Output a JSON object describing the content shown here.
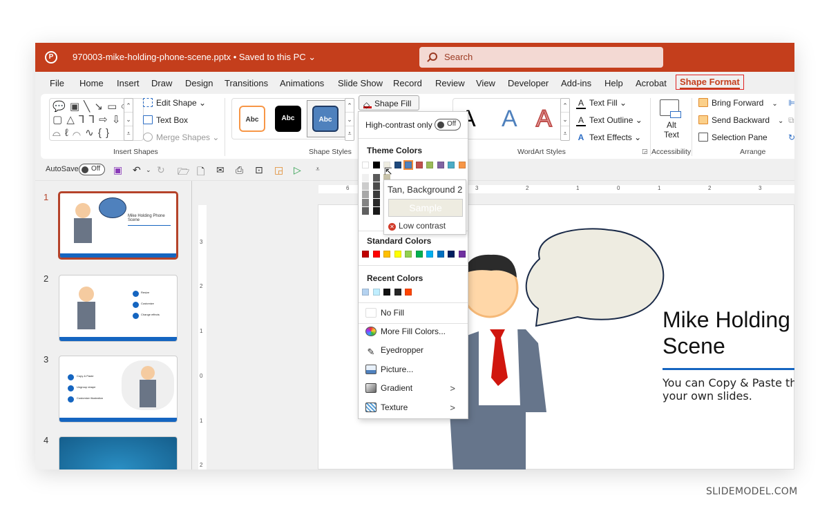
{
  "titlebar": {
    "app_icon": "powerpoint-icon",
    "doc_title": "970003-mike-holding-phone-scene.pptx • Saved to this PC ⌄",
    "search_placeholder": "Search"
  },
  "tabs": [
    {
      "label": "File"
    },
    {
      "label": "Home"
    },
    {
      "label": "Insert"
    },
    {
      "label": "Draw"
    },
    {
      "label": "Design"
    },
    {
      "label": "Transitions"
    },
    {
      "label": "Animations"
    },
    {
      "label": "Slide Show"
    },
    {
      "label": "Record"
    },
    {
      "label": "Review"
    },
    {
      "label": "View"
    },
    {
      "label": "Developer"
    },
    {
      "label": "Add-ins"
    },
    {
      "label": "Help"
    },
    {
      "label": "Acrobat"
    },
    {
      "label": "Shape Format",
      "active": true
    }
  ],
  "ribbon": {
    "insert_shapes": {
      "label": "Insert Shapes",
      "edit_shape": "Edit Shape ⌄",
      "text_box": "Text Box",
      "merge_shapes": "Merge Shapes ⌄",
      "gallery_rows": [
        "💬 ▣ ╲ ↘ ▭ ⬭",
        "▢ △ ⅂ ⅂ ⇨ ⇩",
        "⌓ ℓ ⌒ ∿ { }"
      ]
    },
    "shape_styles": {
      "label": "Shape Styles",
      "samples": [
        "Abc",
        "Abc",
        "Abc"
      ],
      "shape_fill": "Shape Fill ⌄"
    },
    "wordart_styles": {
      "label": "WordArt Styles",
      "samples": [
        "A",
        "A",
        "A"
      ],
      "text_fill": "Text Fill ⌄",
      "text_outline": "Text Outline ⌄",
      "text_effects": "Text Effects ⌄"
    },
    "accessibility": {
      "label": "Accessibility",
      "alt_text_1": "Alt",
      "alt_text_2": "Text"
    },
    "arrange": {
      "label": "Arrange",
      "bring_forward": "Bring Forward",
      "send_backward": "Send Backward",
      "selection_pane": "Selection Pane"
    }
  },
  "qat": {
    "autosave_label": "AutoSave",
    "autosave_state": "Off"
  },
  "slides": [
    {
      "num": "1",
      "title": "Mike Holding Phone Scene",
      "selected": true
    },
    {
      "num": "2",
      "items": [
        "Resize",
        "Customize",
        "Change effects"
      ]
    },
    {
      "num": "3",
      "items": [
        "Copy & Paste",
        "Ungroup shape",
        "Customize illustration"
      ]
    },
    {
      "num": "4"
    }
  ],
  "rulers": {
    "horizontal": [
      "6",
      "3",
      "2",
      "1",
      "0",
      "1",
      "2",
      "3"
    ],
    "vertical": [
      "3",
      "2",
      "1",
      "0",
      "1",
      "2"
    ]
  },
  "slide": {
    "title_line1": "Mike Holding",
    "title_line2": "Scene",
    "subtitle_line1": "You can Copy & Paste the i",
    "subtitle_line2": "your own slides.",
    "bubble_fill": "#EEECE1"
  },
  "fill_menu": {
    "high_contrast_label": "High-contrast only",
    "high_contrast_state": "Off",
    "theme_colors_label": "Theme Colors",
    "theme_colors": [
      "#FFFFFF",
      "#000000",
      "#EEECE1",
      "#1F497D",
      "#4F81BD",
      "#C0504D",
      "#9BBB59",
      "#8064A2",
      "#4BACC6",
      "#F79646"
    ],
    "standard_colors_label": "Standard Colors",
    "standard_colors": [
      "#C00000",
      "#FF0000",
      "#FFC000",
      "#FFFF00",
      "#92D050",
      "#00B050",
      "#00B0F0",
      "#0070C0",
      "#002060",
      "#7030A0"
    ],
    "recent_colors_label": "Recent Colors",
    "recent_colors": [
      "#B4D2F0",
      "#C0EEFF",
      "#111111",
      "#262626",
      "#FF4500"
    ],
    "no_fill": "No Fill",
    "more_fill_colors": "More Fill Colors...",
    "eyedropper": "Eyedropper",
    "picture": "Picture...",
    "gradient": "Gradient",
    "texture": "Texture"
  },
  "tooltip": {
    "name": "Tan, Background 2",
    "sample": "Sample",
    "warning": "Low contrast"
  },
  "watermark": "SLIDEMODEL.COM"
}
